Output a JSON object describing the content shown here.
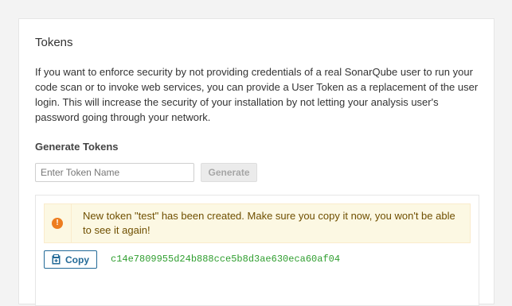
{
  "panel": {
    "title": "Tokens",
    "description": "If you want to enforce security by not providing credentials of a real SonarQube user to run your code scan or to invoke web services, you can provide a User Token as a replacement of the user login. This will increase the security of your installation by not letting your analysis user's password going through your network."
  },
  "generate": {
    "title": "Generate Tokens",
    "input_value": "",
    "input_placeholder": "Enter Token Name",
    "button_label": "Generate",
    "button_disabled": true
  },
  "result": {
    "alert_icon": "exclamation-circle-icon",
    "alert_message": "New token \"test\" has been created. Make sure you copy it now, you won't be able to see it again!",
    "copy_icon": "clipboard-icon",
    "copy_label": "Copy",
    "token": "c14e7809955d24b888cce5b8d3ae630eca60af04"
  },
  "colors": {
    "page_background": "#f3f3f3",
    "alert_background": "#fcf8e3",
    "alert_icon": "#ed7d20",
    "alert_text": "#6f4f00",
    "copy_button": "#236a97",
    "token_text": "#2f9e2f",
    "disabled_button": "#ebebeb"
  }
}
